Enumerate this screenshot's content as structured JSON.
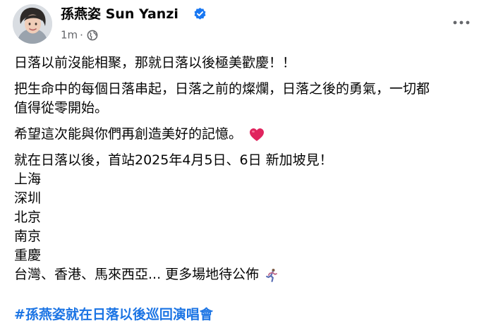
{
  "author": {
    "name": "孫燕姿 Sun Yanzi",
    "verified_icon": "verified-badge-icon",
    "avatar_icon": "avatar"
  },
  "meta": {
    "time": "1m",
    "separator": "·",
    "audience_icon": "globe-icon"
  },
  "menu_icon": "more-horizontal-icon",
  "post": {
    "line1": "日落以前沒能相聚，那就日落以後極美歡慶！！",
    "line2a": "把生命中的每個日落串起，日落之前的燦爛，日落之後的勇氣，一切都",
    "line2b": "值得從零開始。",
    "line3": "希望這次能與你們再創造美好的記憶。",
    "line4": "就在日落以後，首站2025年4月5日、6日 新加坡見！",
    "cities": [
      "上海",
      "深圳",
      "北京",
      "南京",
      "重慶"
    ],
    "line_last": "台灣、香港、馬來西亞... 更多場地待公佈",
    "hashtag": "#孫燕姿就在日落以後巡回演唱會"
  },
  "colors": {
    "text": "#050505",
    "meta": "#65676b",
    "link": "#1b74e4",
    "verified": "#1877f2",
    "heart": "#e0245e"
  }
}
